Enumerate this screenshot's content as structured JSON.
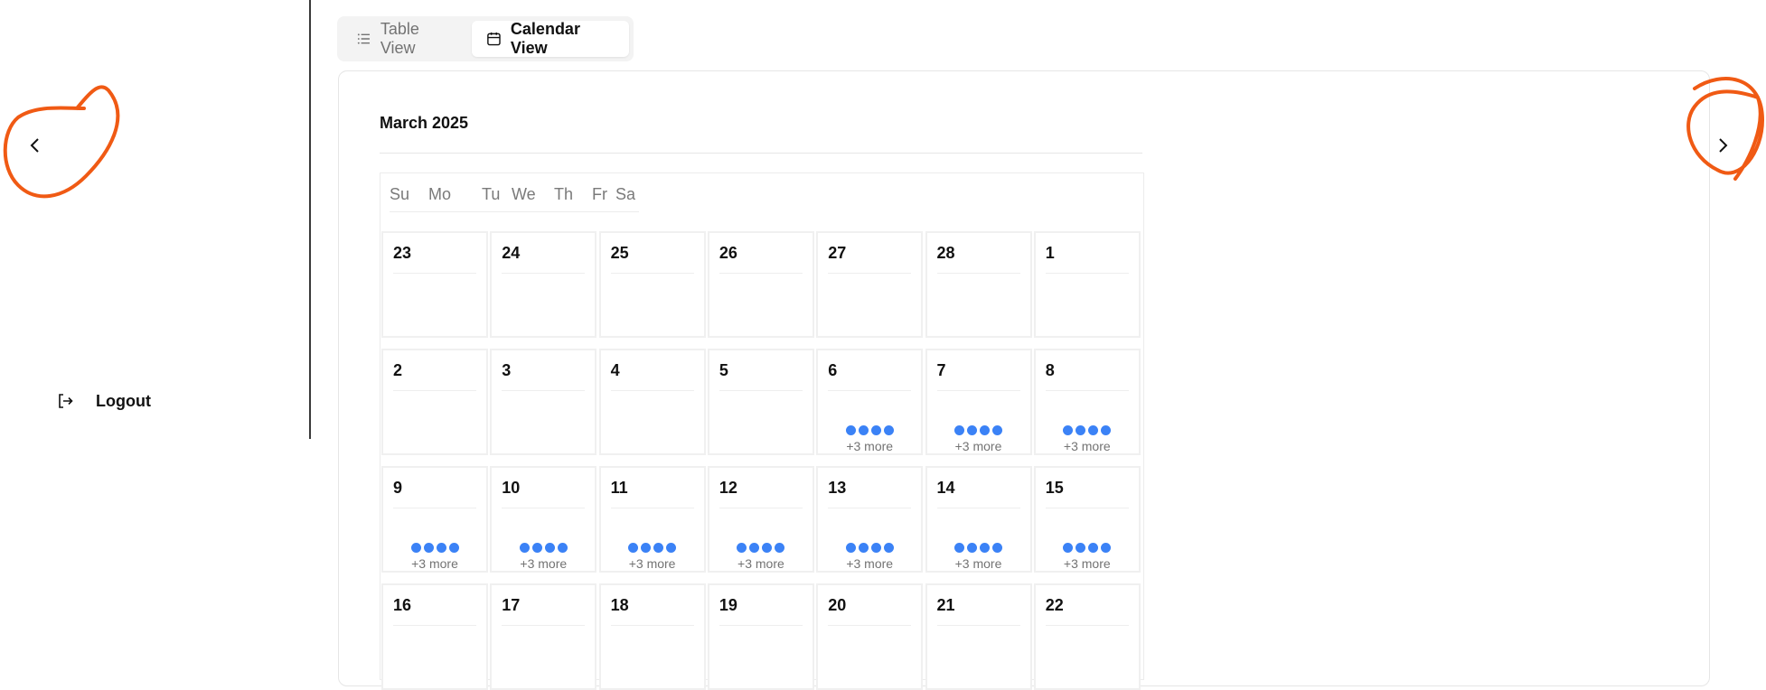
{
  "sidebar": {
    "logout_label": "Logout"
  },
  "view_toggle": {
    "table_label": "Table View",
    "calendar_label": "Calendar View",
    "active": "Calendar View"
  },
  "calendar": {
    "month_title": "March 2025",
    "weekdays": [
      "Su",
      "Mo",
      "Tu",
      "We",
      "Th",
      "Fr",
      "Sa"
    ],
    "weeks": [
      [
        {
          "day": "23"
        },
        {
          "day": "24"
        },
        {
          "day": "25"
        },
        {
          "day": "26"
        },
        {
          "day": "27"
        },
        {
          "day": "28"
        },
        {
          "day": "1"
        }
      ],
      [
        {
          "day": "2"
        },
        {
          "day": "3"
        },
        {
          "day": "4"
        },
        {
          "day": "5"
        },
        {
          "day": "6",
          "more": "+3 more"
        },
        {
          "day": "7",
          "more": "+3 more"
        },
        {
          "day": "8",
          "more": "+3 more"
        }
      ],
      [
        {
          "day": "9",
          "more": "+3 more"
        },
        {
          "day": "10",
          "more": "+3 more"
        },
        {
          "day": "11",
          "more": "+3 more"
        },
        {
          "day": "12",
          "more": "+3 more"
        },
        {
          "day": "13",
          "more": "+3 more"
        },
        {
          "day": "14",
          "more": "+3 more"
        },
        {
          "day": "15",
          "more": "+3 more"
        }
      ],
      [
        {
          "day": "16"
        },
        {
          "day": "17"
        },
        {
          "day": "18"
        },
        {
          "day": "19"
        },
        {
          "day": "20"
        },
        {
          "day": "21"
        },
        {
          "day": "22"
        }
      ]
    ],
    "event_dots_per_day": 4,
    "dot_color": "#3b82f6"
  },
  "navigation": {
    "prev_icon": "chevron-left-icon",
    "next_icon": "chevron-right-icon"
  },
  "annotation_color": "#f05a14"
}
